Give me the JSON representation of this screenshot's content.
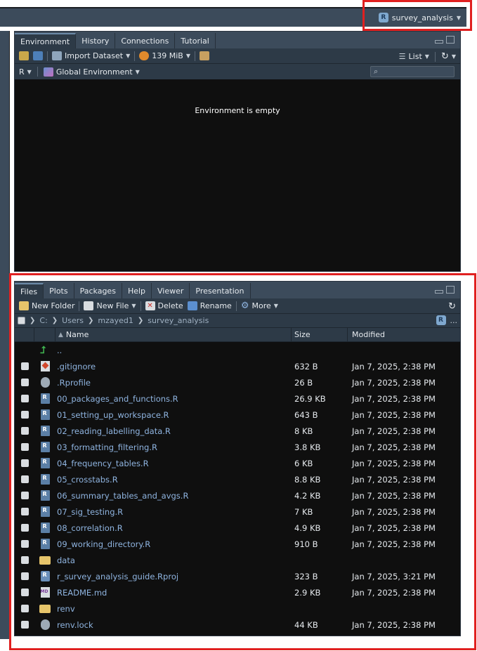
{
  "project": {
    "name": "survey_analysis"
  },
  "env_pane": {
    "tabs": [
      "Environment",
      "History",
      "Connections",
      "Tutorial"
    ],
    "toolbar": {
      "import_dataset": "Import Dataset",
      "memory": "139 MiB",
      "view_mode": "List"
    },
    "toolbar2": {
      "language": "R",
      "scope": "Global Environment"
    },
    "empty_message": "Environment is empty"
  },
  "files_pane": {
    "tabs": [
      "Files",
      "Plots",
      "Packages",
      "Help",
      "Viewer",
      "Presentation"
    ],
    "toolbar": {
      "new_folder": "New Folder",
      "new_file": "New File",
      "delete": "Delete",
      "rename": "Rename",
      "more": "More"
    },
    "breadcrumb": [
      "C:",
      "Users",
      "mzayed1",
      "survey_analysis"
    ],
    "breadcrumb_more": "...",
    "columns": {
      "name": "Name",
      "size": "Size",
      "modified": "Modified"
    },
    "parent_label": "..",
    "rows": [
      {
        "icon": "git",
        "name": ".gitignore",
        "size": "632 B",
        "modified": "Jan 7, 2025, 2:38 PM"
      },
      {
        "icon": "gear",
        "name": ".Rprofile",
        "size": "26 B",
        "modified": "Jan 7, 2025, 2:38 PM"
      },
      {
        "icon": "r",
        "name": "00_packages_and_functions.R",
        "size": "26.9 KB",
        "modified": "Jan 7, 2025, 2:38 PM"
      },
      {
        "icon": "r",
        "name": "01_setting_up_workspace.R",
        "size": "643 B",
        "modified": "Jan 7, 2025, 2:38 PM"
      },
      {
        "icon": "r",
        "name": "02_reading_labelling_data.R",
        "size": "8 KB",
        "modified": "Jan 7, 2025, 2:38 PM"
      },
      {
        "icon": "r",
        "name": "03_formatting_filtering.R",
        "size": "3.8 KB",
        "modified": "Jan 7, 2025, 2:38 PM"
      },
      {
        "icon": "r",
        "name": "04_frequency_tables.R",
        "size": "6 KB",
        "modified": "Jan 7, 2025, 2:38 PM"
      },
      {
        "icon": "r",
        "name": "05_crosstabs.R",
        "size": "8.8 KB",
        "modified": "Jan 7, 2025, 2:38 PM"
      },
      {
        "icon": "r",
        "name": "06_summary_tables_and_avgs.R",
        "size": "4.2 KB",
        "modified": "Jan 7, 2025, 2:38 PM"
      },
      {
        "icon": "r",
        "name": "07_sig_testing.R",
        "size": "7 KB",
        "modified": "Jan 7, 2025, 2:38 PM"
      },
      {
        "icon": "r",
        "name": "08_correlation.R",
        "size": "4.9 KB",
        "modified": "Jan 7, 2025, 2:38 PM"
      },
      {
        "icon": "r",
        "name": "09_working_directory.R",
        "size": "910 B",
        "modified": "Jan 7, 2025, 2:38 PM"
      },
      {
        "icon": "folder",
        "name": "data",
        "size": "",
        "modified": ""
      },
      {
        "icon": "rproj",
        "name": "r_survey_analysis_guide.Rproj",
        "size": "323 B",
        "modified": "Jan 7, 2025, 3:21 PM"
      },
      {
        "icon": "md",
        "name": "README.md",
        "size": "2.9 KB",
        "modified": "Jan 7, 2025, 2:38 PM"
      },
      {
        "icon": "folder",
        "name": "renv",
        "size": "",
        "modified": ""
      },
      {
        "icon": "gear",
        "name": "renv.lock",
        "size": "44 KB",
        "modified": "Jan 7, 2025, 2:38 PM"
      }
    ]
  },
  "colors": {
    "pane_bg": "#0f0f0f",
    "toolbar_bg": "#2d3a47",
    "tab_bg": "#3c4b5b",
    "link": "#8fb4e0",
    "annotation": "#e02020"
  }
}
